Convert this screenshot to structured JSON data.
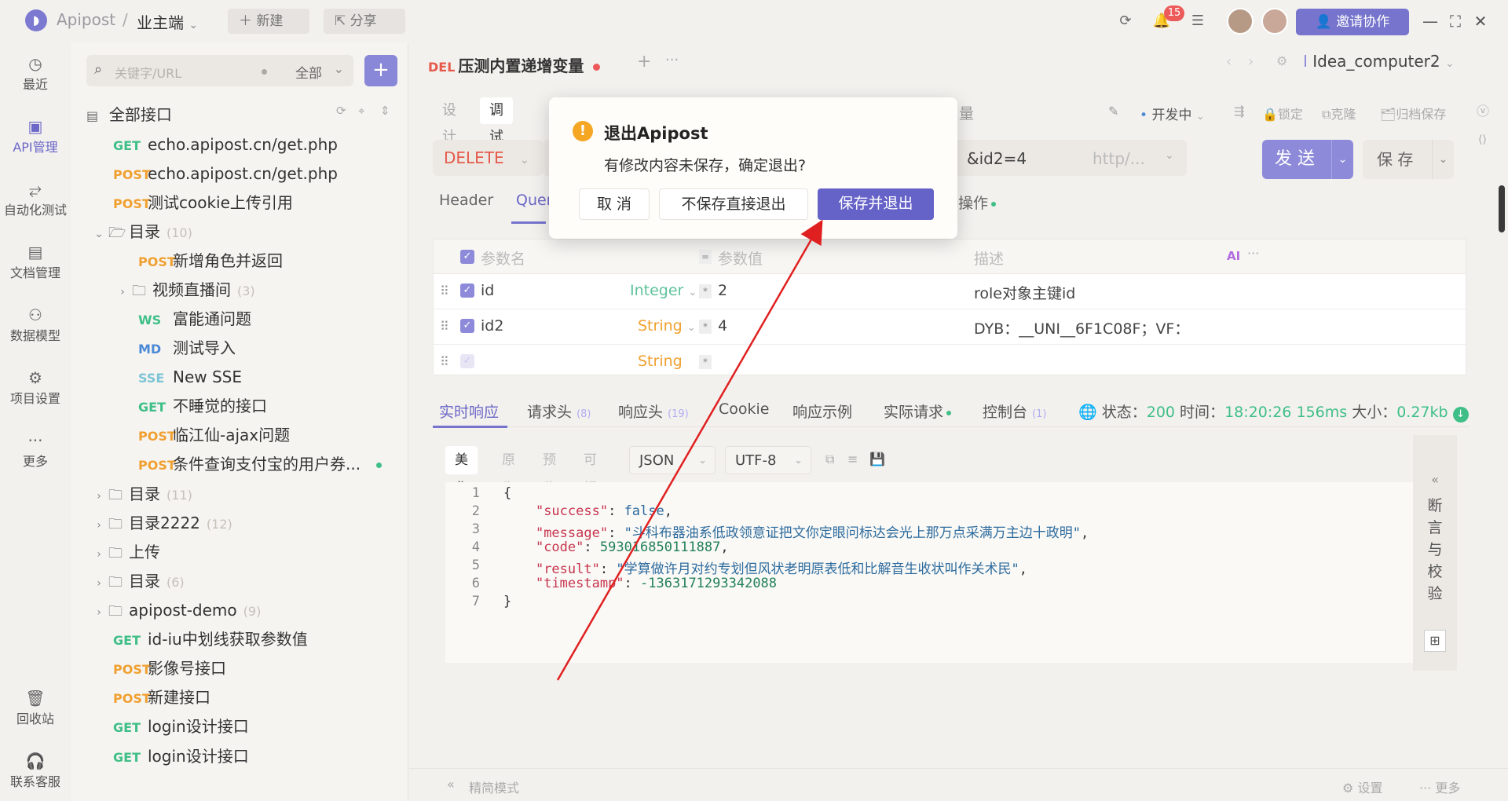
{
  "topbar": {
    "app_name": "Apipost",
    "separator": "/",
    "project": "业主端",
    "new_label": "新建",
    "share_label": "分享",
    "notification_count": "15",
    "invite_label": "邀请协作"
  },
  "leftnav": [
    {
      "label": "最近",
      "icon": "clock-icon"
    },
    {
      "label": "API管理",
      "icon": "api-icon"
    },
    {
      "label": "自动化测试",
      "icon": "flow-icon"
    },
    {
      "label": "文档管理",
      "icon": "doc-icon"
    },
    {
      "label": "数据模型",
      "icon": "model-icon"
    },
    {
      "label": "项目设置",
      "icon": "settings-icon"
    },
    {
      "label": "更多",
      "icon": "more-icon"
    },
    {
      "label": "回收站",
      "icon": "trash-icon"
    },
    {
      "label": "联系客服",
      "icon": "headset-icon"
    }
  ],
  "tree": {
    "search_placeholder": "关键字/URL",
    "filter_label": "全部",
    "header": "全部接口",
    "items": [
      {
        "method": "GET",
        "name": "echo.apipost.cn/get.php"
      },
      {
        "method": "POST",
        "name": "echo.apipost.cn/get.php"
      },
      {
        "method": "POST",
        "name": "测试cookie上传引用"
      },
      {
        "folder": "目录",
        "count": "(10)"
      },
      {
        "method": "POST",
        "name": "新增角色并返回"
      },
      {
        "folder": "视频直播间",
        "count": "(3)"
      },
      {
        "method": "WS",
        "name": "富能通问题"
      },
      {
        "method": "MD",
        "name": "测试导入"
      },
      {
        "method": "SSE",
        "name": "New SSE"
      },
      {
        "method": "GET",
        "name": "不睡觉的接口"
      },
      {
        "method": "POST",
        "name": "临江仙-ajax问题"
      },
      {
        "method": "POST",
        "name": "条件查询支付宝的用户券..."
      },
      {
        "folder": "目录",
        "count": "(11)"
      },
      {
        "folder": "目录2222",
        "count": "(12)"
      },
      {
        "folder": "上传",
        "count": ""
      },
      {
        "folder": "目录",
        "count": "(6)"
      },
      {
        "folder": "apipost-demo",
        "count": "(9)"
      },
      {
        "method": "GET",
        "name": "id-iu中划线获取参数值"
      },
      {
        "method": "POST",
        "name": "影像号接口"
      },
      {
        "method": "POST",
        "name": "新建接口"
      },
      {
        "method": "GET",
        "name": "login设计接口"
      },
      {
        "method": "GET",
        "name": "login设计接口"
      }
    ]
  },
  "tab": {
    "method": "DEL",
    "name": "压测内置递增变量",
    "env": "Idea_computer2"
  },
  "subtabs": [
    "设计",
    "调试"
  ],
  "partial_tab_suffix": "量",
  "status": {
    "env_state": "开发中",
    "lock": "锁定",
    "clone": "克隆",
    "archive": "归档保存"
  },
  "request": {
    "method": "DELETE",
    "url_tail": "&id2=4",
    "prefix": "http/...",
    "send": "发 送",
    "save": "保 存"
  },
  "param_tabs": [
    "Header",
    "Query",
    "后执行操作"
  ],
  "params": {
    "headers": [
      "参数名",
      "参数值",
      "描述"
    ],
    "ai_label": "AI",
    "rows": [
      {
        "name": "id",
        "type": "Integer",
        "value": "2",
        "desc": "role对象主键id",
        "checked": true
      },
      {
        "name": "id2",
        "type": "String",
        "value": "4",
        "desc": "DYB：__UNI__6F1C08F；VF：",
        "checked": true
      },
      {
        "name": "",
        "type": "String",
        "value": "",
        "desc": "",
        "checked": false
      }
    ]
  },
  "response": {
    "tabs": [
      "实时响应",
      "请求头",
      "响应头",
      "Cookie",
      "响应示例",
      "实际请求",
      "控制台"
    ],
    "req_header_count": "(8)",
    "resp_header_count": "(19)",
    "console_count": "(1)",
    "status_label": "状态：",
    "status_value": "200",
    "time_label": "时间：",
    "time_value": "18:20:26",
    "duration": "156ms",
    "size_label": "大小：",
    "size_value": "0.27kb",
    "view_modes": [
      "美化",
      "原生",
      "预览",
      "可视化"
    ],
    "format": "JSON",
    "encoding": "UTF-8",
    "assert_label": "断言与校验",
    "code_lines": [
      {
        "n": "1"
      },
      {
        "n": "2"
      },
      {
        "n": "3"
      },
      {
        "n": "4"
      },
      {
        "n": "5"
      },
      {
        "n": "6"
      },
      {
        "n": "7"
      }
    ],
    "json": {
      "open": "{",
      "success_key": "\"success\"",
      "success_val": "false",
      "message_key": "\"message\"",
      "message_val": "\"斗科布器油系低政领意证把文你定眼问标达会光上那万点采满万主边十政明\"",
      "code_key": "\"code\"",
      "code_val": "593016850111887",
      "result_key": "\"result\"",
      "result_val": "\"学算做许月对约专划但风状老明原表低和比解音生收状叫作关术民\"",
      "timestamp_key": "\"timestamp\"",
      "timestamp_val": "-1363171293342088",
      "close": "}"
    }
  },
  "footer": {
    "mode": "精简模式",
    "settings": "设置",
    "more": "更多"
  },
  "dialog": {
    "title": "退出Apipost",
    "message": "有修改内容未保存，确定退出?",
    "cancel": "取 消",
    "no_save": "不保存直接退出",
    "save_exit": "保存并退出"
  },
  "colors": {
    "accent": "#6b68c8",
    "get": "#3fbf87",
    "post": "#f0a030",
    "delete": "#e55a4a",
    "arrow": "#e02020"
  }
}
